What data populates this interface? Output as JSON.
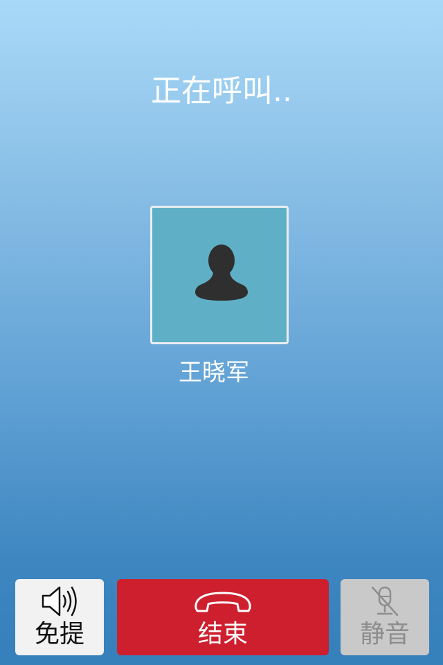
{
  "call": {
    "status": "正在呼叫..",
    "contact_name": "王晓军"
  },
  "controls": {
    "speaker_label": "免提",
    "end_label": "结束",
    "mute_label": "静音",
    "mute_enabled": false
  },
  "icons": {
    "avatar": "person-silhouette-icon",
    "speaker": "speaker-icon",
    "end": "phone-hangup-icon",
    "mute": "microphone-off-icon"
  },
  "colors": {
    "end_button": "#cd1f2e",
    "speaker_button": "#f2f2f2",
    "mute_button_disabled": "#c9c9c9",
    "avatar_background": "#5fb0c6"
  }
}
